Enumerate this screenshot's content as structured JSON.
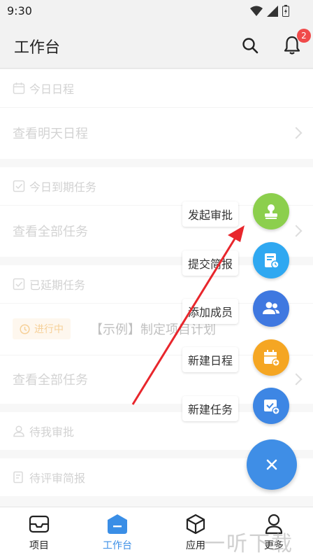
{
  "status": {
    "time": "9:30"
  },
  "header": {
    "title": "工作台",
    "notification_count": "2"
  },
  "sections": {
    "today_schedule": {
      "title": "今日日程",
      "row": "查看明天日程"
    },
    "due_tasks": {
      "title": "今日到期任务",
      "row": "查看全部任务"
    },
    "overdue_tasks": {
      "title": "已延期任务",
      "task_status": "进行中",
      "task_title": "【示例】制定项目计划",
      "row": "查看全部任务"
    },
    "pending_approval": {
      "title": "待我审批"
    },
    "pending_review": {
      "title": "待评审简报"
    }
  },
  "fab_menu": {
    "items": [
      {
        "label": "发起审批",
        "color": "#8ccf4d",
        "icon": "stamp-icon"
      },
      {
        "label": "提交简报",
        "color": "#2fa8f1",
        "icon": "report-icon"
      },
      {
        "label": "添加成员",
        "color": "#3f78e0",
        "icon": "people-icon"
      },
      {
        "label": "新建日程",
        "color": "#f5a623",
        "icon": "calendar-add-icon"
      },
      {
        "label": "新建任务",
        "color": "#3d86e4",
        "icon": "task-add-icon"
      }
    ],
    "main_icon": "close-icon",
    "main_color": "#3f8ee6"
  },
  "tabbar": {
    "items": [
      {
        "label": "项目",
        "icon": "inbox-icon"
      },
      {
        "label": "工作台",
        "icon": "workbench-icon",
        "active": true
      },
      {
        "label": "应用",
        "icon": "cube-icon"
      },
      {
        "label": "更多",
        "icon": "person-icon"
      }
    ]
  },
  "watermark": "一听下载",
  "colors": {
    "accent": "#3a8ee6",
    "badge": "#f04a4a",
    "annotation_arrow": "#e8262c"
  }
}
